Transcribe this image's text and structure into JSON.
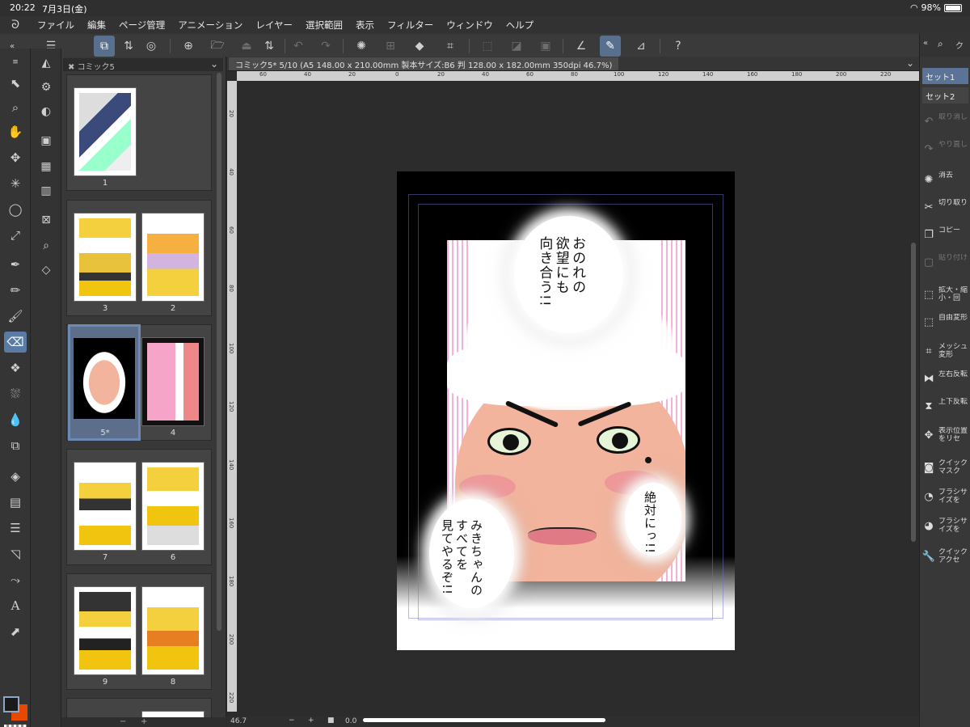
{
  "status_bar": {
    "time": "20:22",
    "date": "7月3日(金)",
    "wifi_icon": "wifi-icon",
    "battery": "98%"
  },
  "menu": {
    "app_icon": "clip-studio-logo",
    "items": [
      "ファイル",
      "編集",
      "ページ管理",
      "アニメーション",
      "レイヤー",
      "選択範囲",
      "表示",
      "フィルター",
      "ウィンドウ",
      "ヘルプ"
    ]
  },
  "page_manager": {
    "tab_label": "コミック5",
    "pages": [
      {
        "number": "1"
      },
      {
        "number": "3"
      },
      {
        "number": "2"
      },
      {
        "number": "5*"
      },
      {
        "number": "4"
      },
      {
        "number": "7"
      },
      {
        "number": "6"
      },
      {
        "number": "9"
      },
      {
        "number": "8"
      }
    ]
  },
  "canvas": {
    "tab_title": "コミック5* 5/10 (A5 148.00 x 210.00mm 製本サイズ:B6 判 128.00 x 182.00mm 350dpi 46.7%)",
    "ruler_h": [
      "60",
      "40",
      "20",
      "0",
      "20",
      "40",
      "60",
      "80",
      "100",
      "120",
      "140",
      "160",
      "180",
      "200",
      "220"
    ],
    "ruler_v": [
      "20",
      "40",
      "60",
      "80",
      "100",
      "120",
      "140",
      "160",
      "180",
      "200",
      "220"
    ],
    "speech": {
      "top": "おのれの\n欲望にも\n向き合う!!",
      "left": "みきちゃんの\nすべてを\n見てやるぞ!!",
      "right": "絶対にっ!!"
    }
  },
  "bottom_bar": {
    "zoom": "46.7",
    "rotate": "0.0",
    "minus": "−",
    "plus": "+"
  },
  "right_panel": {
    "search_icon": "search-icon",
    "sets": [
      "セット1",
      "セット2"
    ],
    "commands": [
      {
        "icon": "undo-icon",
        "label": "取り消し",
        "enabled": false
      },
      {
        "icon": "redo-icon",
        "label": "やり直し",
        "enabled": false
      },
      {
        "icon": "clear-icon",
        "label": "消去",
        "enabled": true
      },
      {
        "icon": "cut-icon",
        "label": "切り取り",
        "enabled": true
      },
      {
        "icon": "copy-icon",
        "label": "コピー",
        "enabled": true
      },
      {
        "icon": "paste-icon",
        "label": "貼り付け",
        "enabled": false
      },
      {
        "icon": "scale-icon",
        "label": "拡大・縮小・回",
        "enabled": true
      },
      {
        "icon": "free-transform-icon",
        "label": "自由変形",
        "enabled": true
      },
      {
        "icon": "mesh-icon",
        "label": "メッシュ変形",
        "enabled": true
      },
      {
        "icon": "flip-h-icon",
        "label": "左右反転",
        "enabled": true
      },
      {
        "icon": "flip-v-icon",
        "label": "上下反転",
        "enabled": true
      },
      {
        "icon": "reset-view-icon",
        "label": "表示位置をリセ",
        "enabled": true
      },
      {
        "icon": "quick-mask-icon",
        "label": "クイックマスク",
        "enabled": true
      },
      {
        "icon": "brush-size-up-icon",
        "label": "ブラシサイズを",
        "enabled": true
      },
      {
        "icon": "brush-size-down-icon",
        "label": "ブラシサイズを",
        "enabled": true
      },
      {
        "icon": "quick-access-icon",
        "label": "クイックアクセ",
        "enabled": true
      }
    ]
  },
  "colors": {
    "accent": "#5a7ba3",
    "main_color": "#1a1a1a",
    "sub_color": "#e84800",
    "speedline": "#eb50aa",
    "skin": "#f2b49c"
  }
}
